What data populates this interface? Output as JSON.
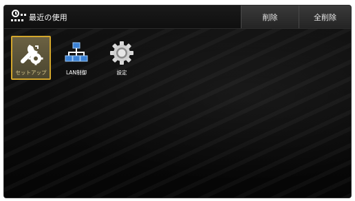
{
  "header": {
    "title": "最近の使用",
    "title_icon": "history-icon",
    "buttons": {
      "delete_label": "削除",
      "delete_all_label": "全削除"
    }
  },
  "items": [
    {
      "label": "セットアップ",
      "icon": "wrench-gear-icon",
      "selected": true
    },
    {
      "label": "LAN制御",
      "icon": "network-icon",
      "selected": false
    },
    {
      "label": "設定",
      "icon": "gear-icon",
      "selected": false
    }
  ],
  "colors": {
    "selection_border": "#d4a72c",
    "background": "#0b0b0b",
    "icon_primary": "#ffffff",
    "network_icon": "#3b82d6"
  }
}
